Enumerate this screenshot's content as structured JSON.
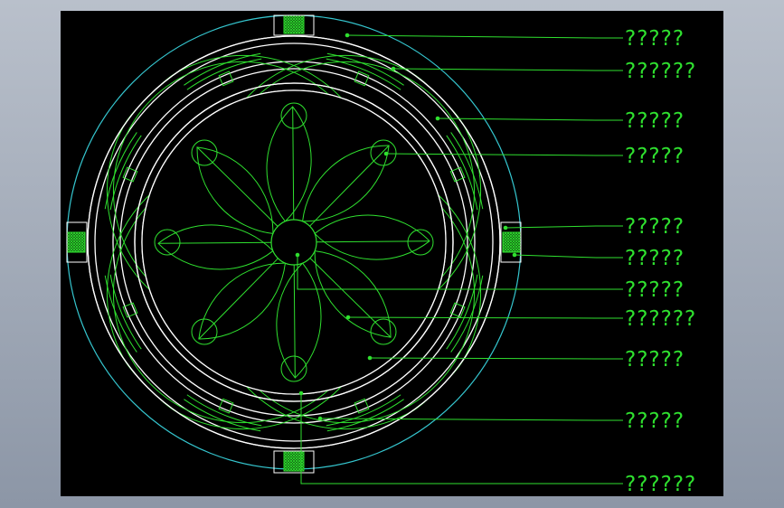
{
  "drawing": {
    "background": "#000000",
    "line_color": "#2fe02f",
    "ring_color": "#ffffff",
    "outer_ring_color": "#35c6cf",
    "labels": [
      {
        "text": "?????"
      },
      {
        "text": "??????"
      },
      {
        "text": "?????"
      },
      {
        "text": "?????"
      },
      {
        "text": "?????"
      },
      {
        "text": "?????"
      },
      {
        "text": "?????"
      },
      {
        "text": "??????"
      },
      {
        "text": "?????"
      },
      {
        "text": "?????"
      },
      {
        "text": "??????"
      }
    ]
  }
}
